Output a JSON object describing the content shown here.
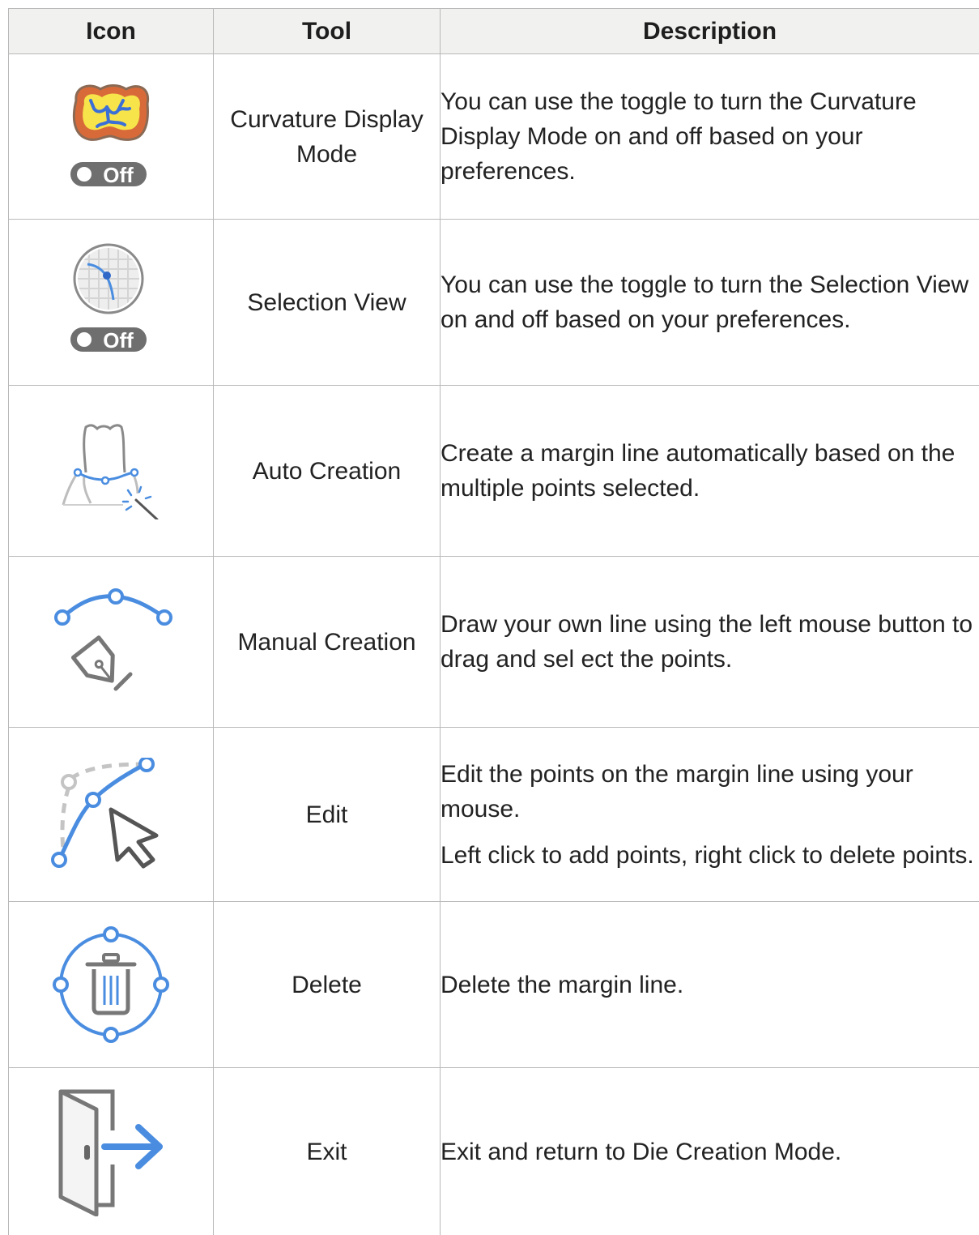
{
  "headers": {
    "icon": "Icon",
    "tool": "Tool",
    "description": "Description"
  },
  "rows": [
    {
      "icon": "curvature-display-mode-icon",
      "toggle": "Off",
      "tool": "Curvature Display Mode",
      "desc": [
        "You can use the toggle to turn the Curvature Display Mode on and off based on your preferences."
      ]
    },
    {
      "icon": "selection-view-icon",
      "toggle": "Off",
      "tool": "Selection View",
      "desc": [
        "You can use the toggle to turn the Selection View on and off based on your preferences."
      ]
    },
    {
      "icon": "auto-creation-icon",
      "tool": "Auto Creation",
      "desc": [
        "Create a margin line automatically based on the multiple points selected."
      ]
    },
    {
      "icon": "manual-creation-pen-icon",
      "tool": "Manual Creation",
      "desc": [
        "Draw your own line using the left mouse button to drag and sel ect the points."
      ]
    },
    {
      "icon": "edit-points-cursor-icon",
      "tool": "Edit",
      "desc": [
        "Edit the points on the margin line using your mouse.",
        "Left click to add points, right click to delete points."
      ]
    },
    {
      "icon": "delete-trash-icon",
      "tool": "Delete",
      "desc": [
        "Delete the margin line."
      ]
    },
    {
      "icon": "exit-door-icon",
      "tool": "Exit",
      "desc": [
        "Exit and return to Die Creation Mode."
      ]
    }
  ],
  "colors": {
    "accent_blue": "#4a8de0",
    "icon_gray": "#777777",
    "toggle_gray": "#6f6f6f",
    "header_bg": "#f1f1ef"
  }
}
